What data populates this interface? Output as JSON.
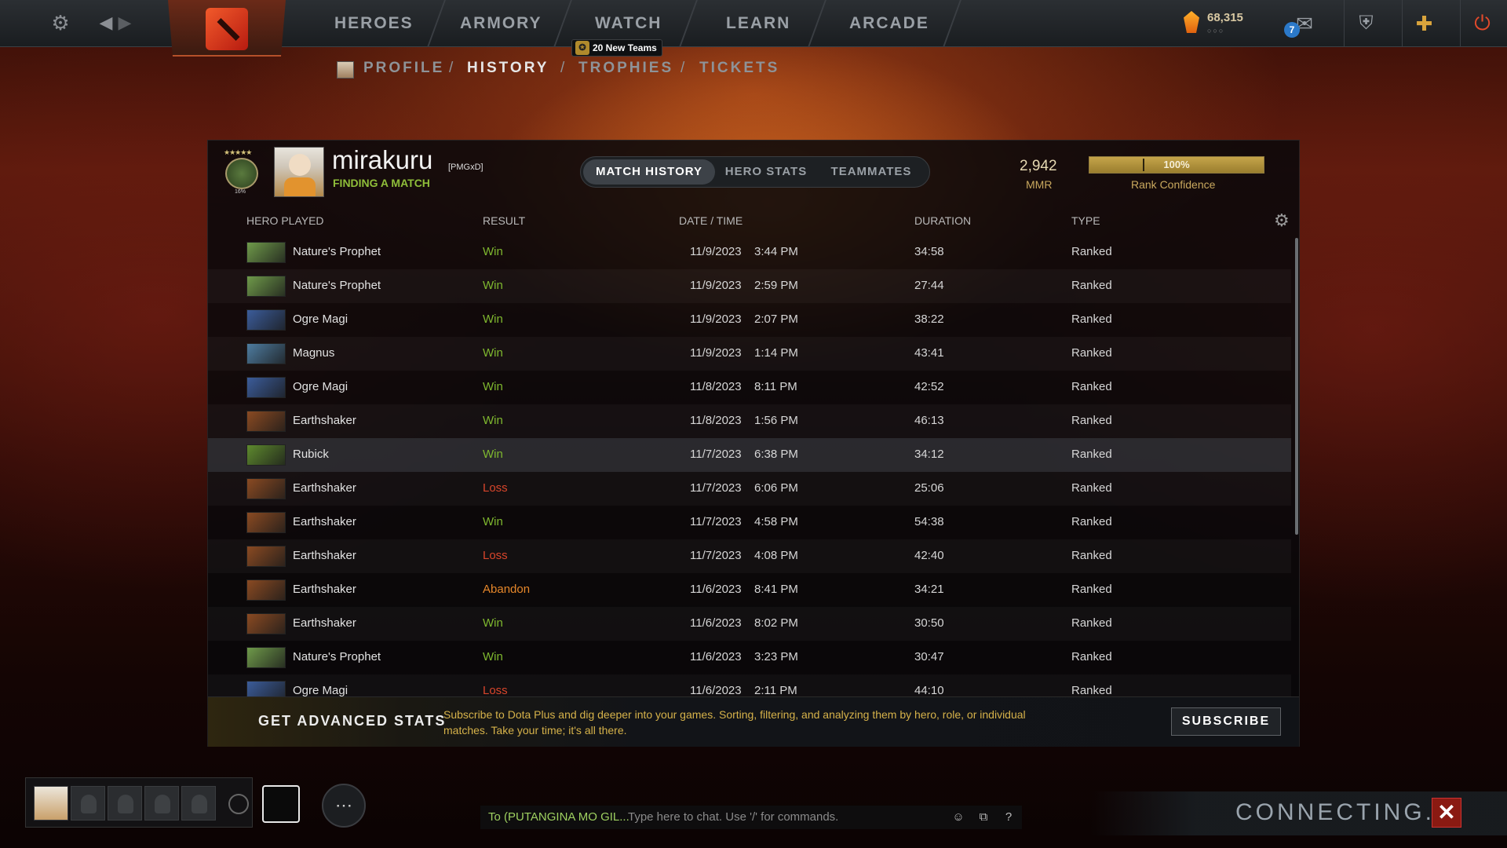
{
  "nav": {
    "items": [
      "HEROES",
      "ARMORY",
      "WATCH",
      "LEARN",
      "ARCADE"
    ],
    "new_teams": "20 New Teams",
    "shards": "68,315",
    "mail_count": "7"
  },
  "subnav": {
    "items": [
      "PROFILE",
      "HISTORY",
      "TROPHIES",
      "TICKETS"
    ],
    "active": "HISTORY"
  },
  "profile": {
    "rank_pct": "16%",
    "username": "mirakuru",
    "clan": "[PMGxD]",
    "status": "FINDING A MATCH",
    "mmr": "2,942",
    "mmr_label": "MMR",
    "confidence": "100%",
    "confidence_value": 1.0,
    "confidence_label": "Rank Confidence"
  },
  "tabs": [
    "MATCH HISTORY",
    "HERO STATS",
    "TEAMMATES"
  ],
  "columns": {
    "hero": "HERO PLAYED",
    "result": "RESULT",
    "date": "DATE / TIME",
    "duration": "DURATION",
    "type": "TYPE"
  },
  "matches": [
    {
      "hero": "Nature's Prophet",
      "result": "Win",
      "date": "11/9/2023",
      "time": "3:44 PM",
      "duration": "34:58",
      "type": "Ranked"
    },
    {
      "hero": "Nature's Prophet",
      "result": "Win",
      "date": "11/9/2023",
      "time": "2:59 PM",
      "duration": "27:44",
      "type": "Ranked"
    },
    {
      "hero": "Ogre Magi",
      "result": "Win",
      "date": "11/9/2023",
      "time": "2:07 PM",
      "duration": "38:22",
      "type": "Ranked"
    },
    {
      "hero": "Magnus",
      "result": "Win",
      "date": "11/9/2023",
      "time": "1:14 PM",
      "duration": "43:41",
      "type": "Ranked"
    },
    {
      "hero": "Ogre Magi",
      "result": "Win",
      "date": "11/8/2023",
      "time": "8:11 PM",
      "duration": "42:52",
      "type": "Ranked"
    },
    {
      "hero": "Earthshaker",
      "result": "Win",
      "date": "11/8/2023",
      "time": "1:56 PM",
      "duration": "46:13",
      "type": "Ranked"
    },
    {
      "hero": "Rubick",
      "result": "Win",
      "date": "11/7/2023",
      "time": "6:38 PM",
      "duration": "34:12",
      "type": "Ranked"
    },
    {
      "hero": "Earthshaker",
      "result": "Loss",
      "date": "11/7/2023",
      "time": "6:06 PM",
      "duration": "25:06",
      "type": "Ranked"
    },
    {
      "hero": "Earthshaker",
      "result": "Win",
      "date": "11/7/2023",
      "time": "4:58 PM",
      "duration": "54:38",
      "type": "Ranked"
    },
    {
      "hero": "Earthshaker",
      "result": "Loss",
      "date": "11/7/2023",
      "time": "4:08 PM",
      "duration": "42:40",
      "type": "Ranked"
    },
    {
      "hero": "Earthshaker",
      "result": "Abandon",
      "date": "11/6/2023",
      "time": "8:41 PM",
      "duration": "34:21",
      "type": "Ranked"
    },
    {
      "hero": "Earthshaker",
      "result": "Win",
      "date": "11/6/2023",
      "time": "8:02 PM",
      "duration": "30:50",
      "type": "Ranked"
    },
    {
      "hero": "Nature's Prophet",
      "result": "Win",
      "date": "11/6/2023",
      "time": "3:23 PM",
      "duration": "30:47",
      "type": "Ranked"
    },
    {
      "hero": "Ogre Magi",
      "result": "Loss",
      "date": "11/6/2023",
      "time": "2:11 PM",
      "duration": "44:10",
      "type": "Ranked"
    }
  ],
  "hero_colors": {
    "Nature's Prophet": "#6f9a4a",
    "Ogre Magi": "#3b5c9a",
    "Magnus": "#4e7ca0",
    "Earthshaker": "#8a4a22",
    "Rubick": "#5e8a2e"
  },
  "result_colors": {
    "Win": "#7fb82f",
    "Loss": "#d8452b",
    "Abandon": "#e6872a"
  },
  "promo": {
    "title": "GET ADVANCED STATS",
    "text": "Subscribe to Dota Plus and dig deeper into your games. Sorting, filtering, and analyzing them by hero, role, or individual matches. Take your time; it's all there.",
    "button": "SUBSCRIBE"
  },
  "chat": {
    "to": "To (PUTANGINA MO GIL...",
    "placeholder": "Type here to chat. Use '/' for commands."
  },
  "connecting": "CONNECTING..."
}
